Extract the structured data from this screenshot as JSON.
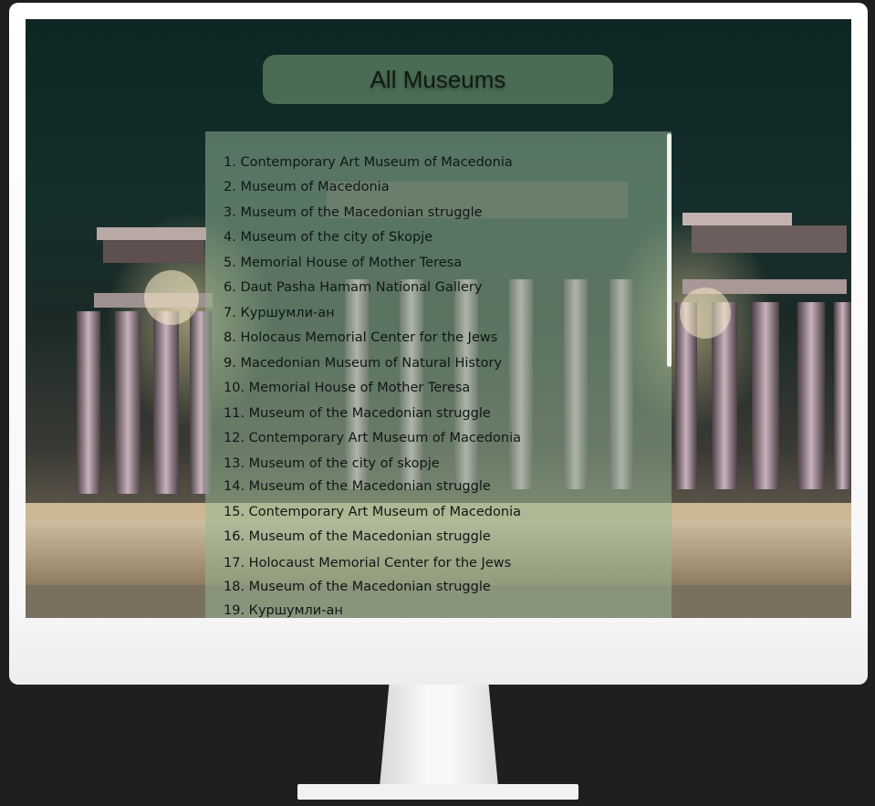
{
  "header": {
    "title": "All Museums"
  },
  "museums": [
    "1. Contemporary Art Museum of Macedonia",
    "2. Museum of Macedonia",
    "3. Museum of the Macedonian struggle",
    "4. Museum of the city of Skopje",
    "5. Memorial House of Mother Teresa",
    "6. Daut Pasha Hamam National Gallery",
    "7. Куршумли-ан",
    "8. Holocaus Memorial Center for the Jews",
    "9. Macedonian Museum of Natural History",
    "10. Memorial House of Mother Teresa",
    "11. Museum of the Macedonian struggle",
    "12. Contemporary Art Museum of Macedonia",
    "13. Museum of the city of skopje",
    "14. Museum of the Macedonian struggle",
    "15. Contemporary Art Museum of Macedonia",
    "16. Museum of the Macedonian struggle",
    "17. Holocaust Memorial Center for the Jews",
    "18. Museum of the Macedonian struggle",
    "19. Куршумли-ан"
  ],
  "colors": {
    "page_background": "#1f1f1f",
    "title_pill": "#6e966e",
    "list_panel": "#96b996",
    "text": "#0f1714"
  }
}
